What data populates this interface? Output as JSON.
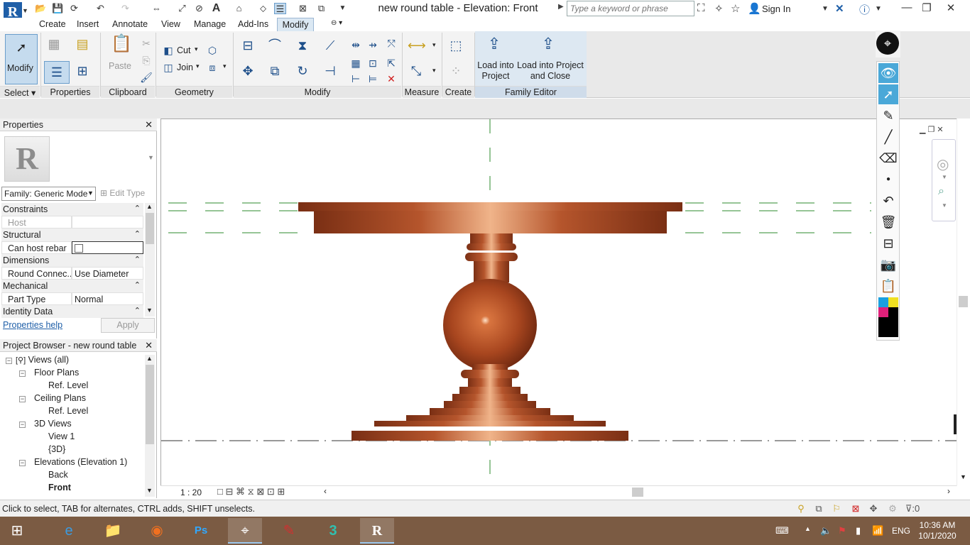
{
  "app": {
    "logo_letter": "R",
    "window_title": "new round table - Elevation: Front",
    "search_placeholder": "Type a keyword or phrase",
    "sign_in": "Sign In"
  },
  "tabs": [
    "Create",
    "Insert",
    "Annotate",
    "View",
    "Manage",
    "Add-Ins",
    "Modify"
  ],
  "active_tab": "Modify",
  "ribbon": {
    "modify_label": "Modify",
    "cut_label": "Cut",
    "join_label": "Join",
    "paste_label": "Paste",
    "load_into_project": "Load into Project",
    "load_into_project_and_close": "Load into Project and Close",
    "panels": {
      "select": "Select",
      "properties": "Properties",
      "clipboard": "Clipboard",
      "geometry": "Geometry",
      "modify": "Modify",
      "measure": "Measure",
      "create": "Create",
      "family_editor": "Family Editor"
    }
  },
  "properties": {
    "title": "Properties",
    "thumb_letter": "R",
    "family_value": "Family: Generic Model",
    "edit_type": "Edit Type",
    "groups": {
      "constraints": "Constraints",
      "structural": "Structural",
      "dimensions": "Dimensions",
      "mechanical": "Mechanical",
      "identity": "Identity Data"
    },
    "rows": {
      "host_key": "Host",
      "host_value": "",
      "rebar_key": "Can host rebar",
      "round_key": "Round Connec...",
      "round_value": "Use Diameter",
      "part_key": "Part Type",
      "part_value": "Normal"
    },
    "help_link": "Properties help",
    "apply": "Apply"
  },
  "browser": {
    "title": "Project Browser - new round table",
    "nodes": {
      "views_all": "Views (all)",
      "floor_plans": "Floor Plans",
      "fp_ref_level": "Ref. Level",
      "ceiling_plans": "Ceiling Plans",
      "cp_ref_level": "Ref. Level",
      "views_3d": "3D Views",
      "view_1": "View 1",
      "view_3d": "{3D}",
      "elevations": "Elevations (Elevation 1)",
      "back": "Back",
      "front": "Front"
    }
  },
  "view": {
    "scale": "1 : 20"
  },
  "status": {
    "text": "Click to select, TAB for alternates, CTRL adds, SHIFT unselects.",
    "filter_count": ":0"
  },
  "taskbar": {
    "time": "10:36 AM",
    "date": "10/1/2020",
    "lang": "ENG"
  },
  "colors": {
    "wood": "#b5552c",
    "ref_line": "#2e8b2e",
    "ribbon_active": "#c5dbee",
    "taskbar": "#7b5b43"
  }
}
